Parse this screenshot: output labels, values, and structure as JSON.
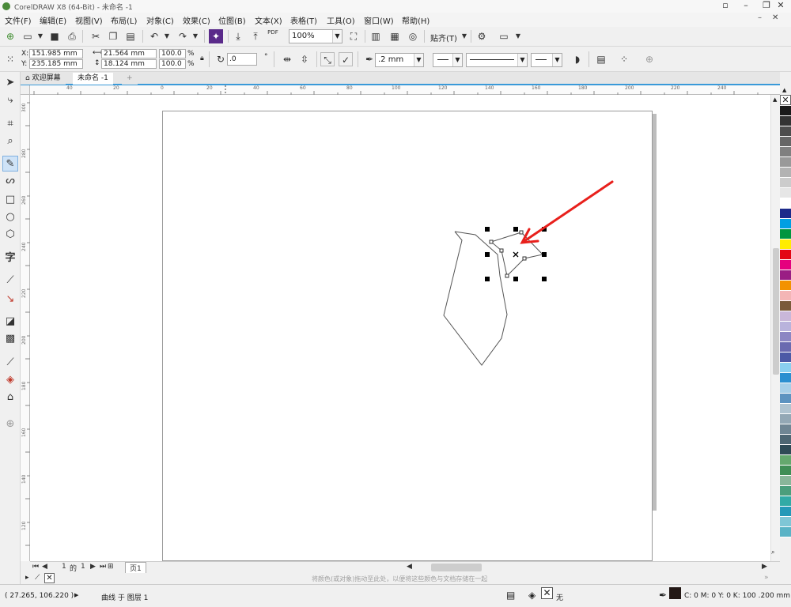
{
  "window": {
    "title": "CorelDRAW X8 (64-Bit) - 未命名 -1",
    "icons": [
      "user-icon",
      "minimize-icon",
      "restore-icon",
      "close-icon"
    ]
  },
  "menu": {
    "items": [
      "文件(F)",
      "编辑(E)",
      "视图(V)",
      "布局(L)",
      "对象(C)",
      "效果(C)",
      "位图(B)",
      "文本(X)",
      "表格(T)",
      "工具(O)",
      "窗口(W)",
      "帮助(H)"
    ]
  },
  "toolbar": {
    "zoom_value": "100%",
    "snap_label": "贴齐(T)",
    "pdf_label": "PDF"
  },
  "property_bar": {
    "x_label": "X:",
    "x_value": "151.985 mm",
    "y_label": "Y:",
    "y_value": "235.185 mm",
    "width_value": "21.564 mm",
    "height_value": "18.124 mm",
    "scale_x": "100.0",
    "scale_y": "100.0",
    "percent": "%",
    "rotation_value": ".0",
    "rotation_unit": "°",
    "outline_width": ".2 mm"
  },
  "tabs": {
    "welcome": "欢迎屏幕",
    "document": "未命名 -1",
    "add": "+"
  },
  "ruler": {
    "horizontal": [
      "40",
      "20",
      "0",
      "20",
      "40",
      "60",
      "80",
      "100",
      "120",
      "140",
      "160",
      "180",
      "200",
      "220",
      "240"
    ],
    "vertical": [
      "300",
      "280",
      "260",
      "240",
      "220",
      "200",
      "180",
      "160",
      "140",
      "120"
    ]
  },
  "page_nav": {
    "current": "1",
    "of": "的",
    "total": "1",
    "page_tab": "页1"
  },
  "hint": "将颜色(或对象)拖动至此处，以便将这些颜色与文档存储在一起",
  "status": {
    "coords": "( 27.265, 106.220 )",
    "object_info": "曲线 于 图层 1",
    "fill_none": "无",
    "outline_info": "C: 0 M: 0 Y: 0 K: 100  .200 mm"
  },
  "colors": {
    "accent": "#3a9ad9",
    "arrow": "#e8201c",
    "outline_swatch": "#231815",
    "palette": [
      "#1a1a1a",
      "#333333",
      "#4d4d4d",
      "#666666",
      "#808080",
      "#999999",
      "#b3b3b3",
      "#cccccc",
      "#e6e6e6",
      "#ffffff",
      "#1c2a8a",
      "#009fe3",
      "#00963f",
      "#ffed00",
      "#e30613",
      "#e5007e",
      "#9a1e84",
      "#f39200",
      "#f4b6b6",
      "#7a5a3a",
      "#c9b7d9",
      "#b9b3dc",
      "#8c86c3",
      "#6a6ab0",
      "#4c5aa6",
      "#8ad0f0",
      "#2b8fd0",
      "#a6cfe8",
      "#5c93c0",
      "#b0c4d0",
      "#93a8b5",
      "#6f8694",
      "#4d6673",
      "#2e4a56",
      "#64a86e",
      "#3f8e56",
      "#89b69a",
      "#4b9e7c",
      "#31aaa6",
      "#2499b8",
      "#7fc6d6",
      "#5ab3c6"
    ]
  }
}
